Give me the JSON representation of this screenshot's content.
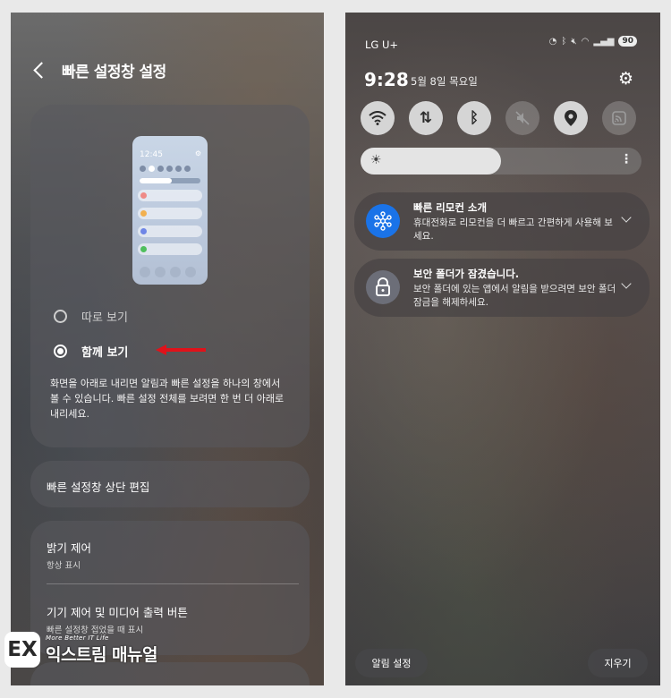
{
  "left": {
    "header": {
      "title": "빠른 설정창 설정"
    },
    "preview": {
      "time": "12:45"
    },
    "options": [
      {
        "label": "따로 보기",
        "selected": false
      },
      {
        "label": "함께 보기",
        "selected": true
      }
    ],
    "description": "화면을 아래로 내리면 알림과 빠른 설정을 하나의 창에서 볼 수 있습니다. 빠른 설정 전체를 보려면 한 번 더 아래로 내리세요.",
    "edit_item": {
      "title": "빠른 설정창 상단 편집"
    },
    "brightness_item": {
      "title": "밝기 제어",
      "sub": "항상 표시"
    },
    "media_item": {
      "title": "기기 제어 및 미디어 출력 버튼",
      "sub": "빠른 설정창 접었을 때 표시"
    },
    "arrow_color": "#e0121a"
  },
  "watermark": {
    "logo": "EX",
    "tagline": "More Better IT Life",
    "name": "익스트림 매뉴얼"
  },
  "right": {
    "status": {
      "carrier": "LG U+",
      "battery": "90"
    },
    "clock": {
      "time": "9:28",
      "date": "5월 8일 목요일"
    },
    "tiles": [
      {
        "icon": "wifi-icon",
        "active": true
      },
      {
        "icon": "mobile-data-icon",
        "active": true
      },
      {
        "icon": "bluetooth-icon",
        "active": true
      },
      {
        "icon": "mute-icon",
        "active": false
      },
      {
        "icon": "location-icon",
        "active": true
      },
      {
        "icon": "cast-icon",
        "active": false
      }
    ],
    "brightness_level": 0.5,
    "notifications": [
      {
        "title": "빠른 리모컨 소개",
        "body": "휴대전화로 리모컨을 더 빠르고 간편하게 사용해 보세요.",
        "icon": "remote-hub-icon",
        "color": "#1a73e8"
      },
      {
        "title": "보안 폴더가 잠겼습니다.",
        "body": "보안 폴더에 있는 앱에서 알림을 받으려면 보안 폴더 잠금을 해제하세요.",
        "icon": "lock-icon",
        "color": "#6c6e78"
      }
    ],
    "buttons": {
      "notification_settings": "알림 설정",
      "clear": "지우기"
    }
  }
}
